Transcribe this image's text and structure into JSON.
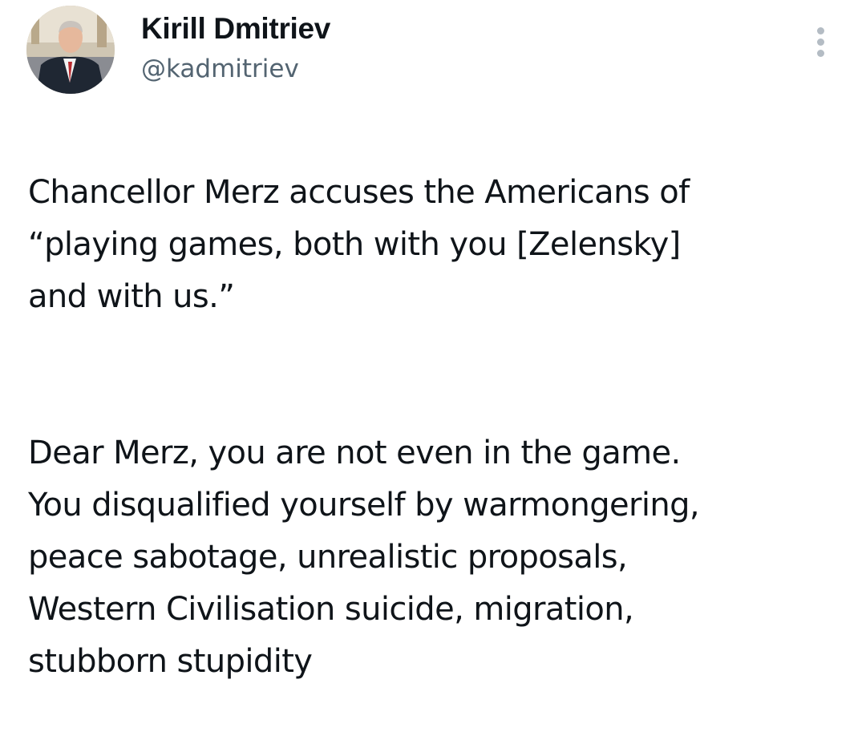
{
  "tweet": {
    "author": {
      "display_name": "Kirill Dmitriev",
      "handle": "@kadmitriev",
      "avatar_icon": "profile-photo"
    },
    "more_icon": "more-vertical-icon",
    "paragraphs": [
      "Chancellor Merz accuses the Americans of\n“playing games, both with you [Zelensky]\nand with us.”",
      "Dear Merz, you are not even in the game.\nYou disqualified yourself by warmongering,\npeace sabotage, unrealistic proposals,\nWestern Civilisation suicide, migration,\nstubborn stupidity"
    ]
  },
  "colors": {
    "text_primary": "#0f1419",
    "text_secondary": "#536471",
    "icon_muted": "#b4bcc4",
    "background": "#ffffff"
  }
}
